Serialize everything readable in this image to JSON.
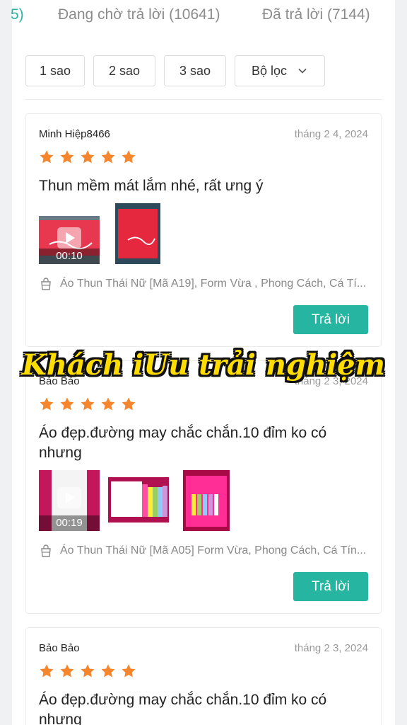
{
  "tabs": {
    "active_fragment": "5)",
    "pending": "Đang chờ trả lời (10641)",
    "answered": "Đã trả lời (7144)"
  },
  "filters": {
    "one_star": "1 sao",
    "two_star": "2 sao",
    "three_star": "3 sao",
    "more": "Bộ lọc"
  },
  "reviews": [
    {
      "reviewer": "Minh Hiệp8466",
      "date": "tháng 2 4, 2024",
      "rating": 5,
      "text": "Thun mềm mát lắm nhé, rất ưng ý",
      "video_duration": "00:10",
      "product": "Áo Thun Thái Nữ [Mã A19], Form Vừa , Phong Cách, Cá Tí...",
      "reply_label": "Trả lời"
    },
    {
      "reviewer": "Bảo Bảo",
      "date": "tháng 2 3, 2024",
      "rating": 5,
      "text": "Áo đẹp.đường may chắc chắn.10 đỉm ko có nhưng",
      "video_duration": "00:19",
      "product": "Áo Thun Thái Nữ [Mã A05] Form Vừa, Phong Cách, Cá Tín...",
      "reply_label": "Trả lời"
    },
    {
      "reviewer": "Bảo Bảo",
      "date": "tháng 2 3, 2024",
      "rating": 5,
      "text": "Áo đẹp.đường may chắc chắn.10 đỉm ko có nhưng"
    }
  ],
  "overlay_caption": "Khách iUu trải nghiệm",
  "colors": {
    "accent": "#26b5a0",
    "star": "#f5862e",
    "overlay_text": "#ffdd00"
  }
}
